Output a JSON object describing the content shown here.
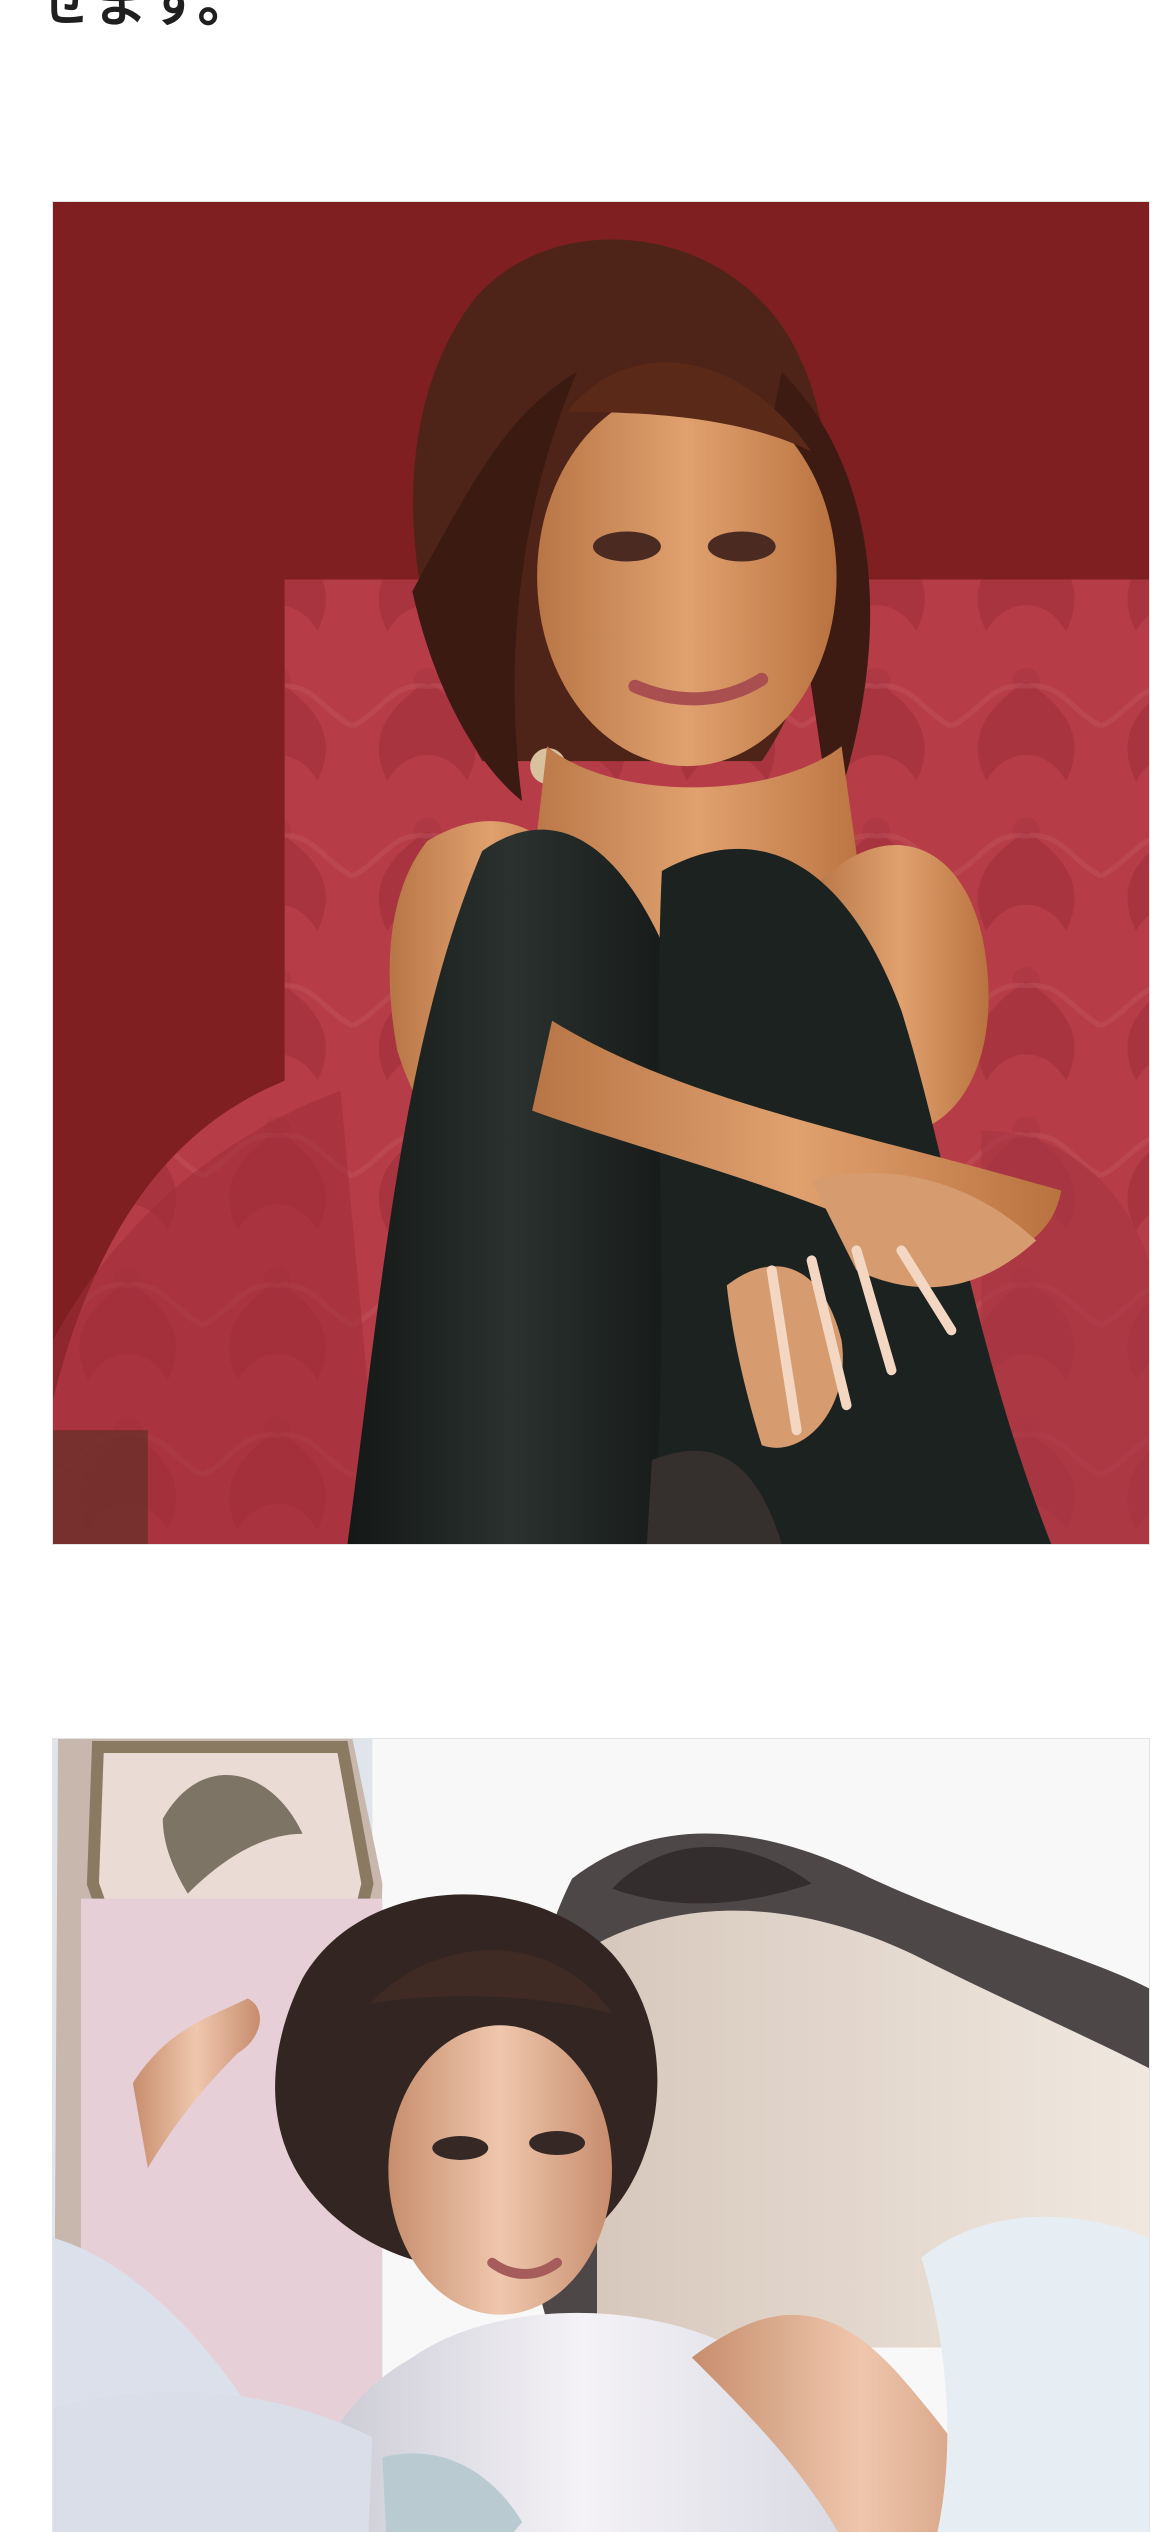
{
  "article": {
    "text_fragment": "せます。"
  },
  "images": [
    {
      "alt": ""
    },
    {
      "alt": ""
    }
  ],
  "colors": {
    "background": "#ffffff",
    "text": "#1f1f1f",
    "image1_bg": "#7e1f21",
    "image1_chair": "#b63d47",
    "image1_dress": "#1f2523",
    "image2_bg": "#f6f7f8",
    "image2_sofa": "#e8ddd4"
  },
  "icons": []
}
